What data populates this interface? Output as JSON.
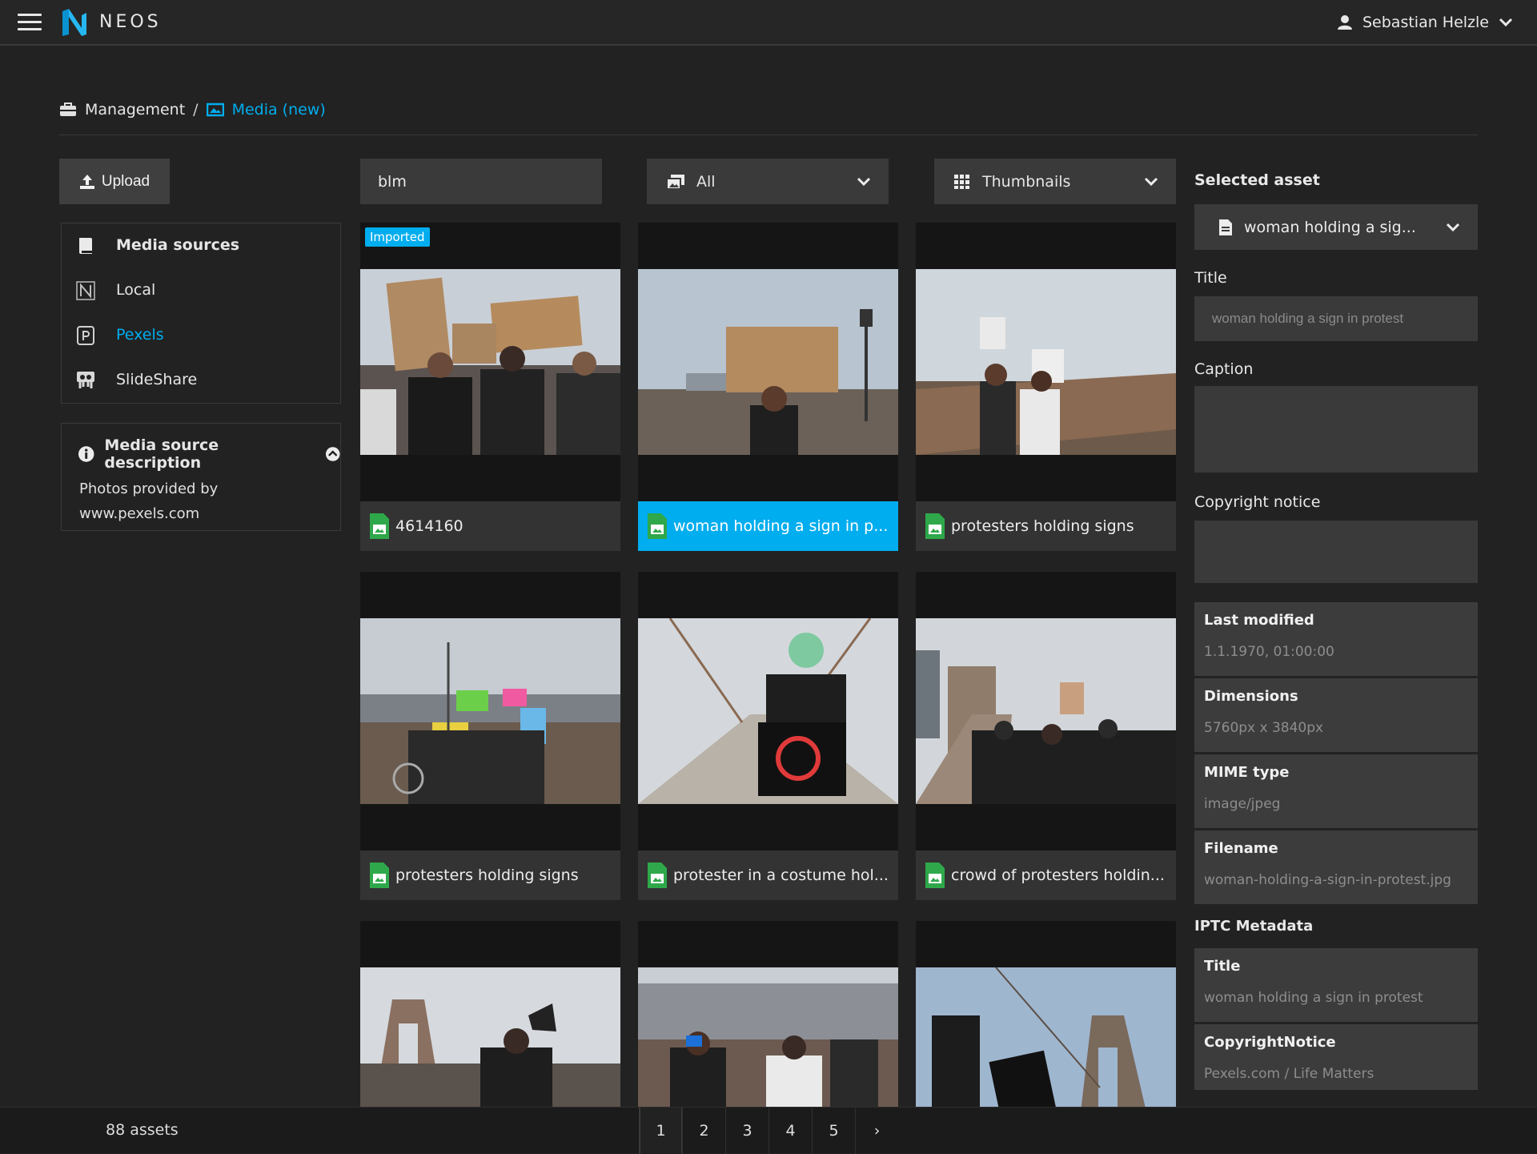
{
  "app": {
    "brand": "NEOS",
    "user_name": "Sebastian Helzle"
  },
  "breadcrumb": [
    {
      "label": "Management",
      "icon": "briefcase-icon"
    },
    {
      "label": "Media (new)",
      "icon": "image-icon"
    }
  ],
  "toolbar": {
    "upload_label": "Upload",
    "search_value": "blm",
    "filter_value": "All",
    "view_value": "Thumbnails"
  },
  "sources": {
    "heading": "Media sources",
    "items": [
      {
        "label": "Local",
        "icon": "neos-icon"
      },
      {
        "label": "Pexels",
        "icon": "pexels-icon",
        "selected": true
      },
      {
        "label": "SlideShare",
        "icon": "slideshare-icon"
      }
    ]
  },
  "description": {
    "heading": "Media source description",
    "line1": "Photos provided by",
    "line2": "www.pexels.com"
  },
  "assets": [
    {
      "caption": "4614160",
      "badge": "Imported"
    },
    {
      "caption": "woman holding a sign in p...",
      "selected": true
    },
    {
      "caption": "protesters holding signs"
    },
    {
      "caption": "protesters holding signs"
    },
    {
      "caption": "protester in a costume hol..."
    },
    {
      "caption": "crowd of protesters holdin..."
    },
    {
      "caption": ""
    },
    {
      "caption": ""
    },
    {
      "caption": ""
    }
  ],
  "selected_panel": {
    "heading": "Selected asset",
    "asset_name": "woman holding a sig...",
    "title_label": "Title",
    "title_value": "woman holding a sign in protest",
    "caption_label": "Caption",
    "caption_value": "",
    "copyright_label": "Copyright notice",
    "copyright_value": "",
    "meta": [
      {
        "key": "Last modified",
        "value": "1.1.1970, 01:00:00"
      },
      {
        "key": "Dimensions",
        "value": "5760px x 3840px"
      },
      {
        "key": "MIME type",
        "value": "image/jpeg"
      },
      {
        "key": "Filename",
        "value": "woman-holding-a-sign-in-protest.jpg"
      }
    ],
    "iptc_heading": "IPTC Metadata",
    "iptc": [
      {
        "key": "Title",
        "value": "woman holding a sign in protest"
      },
      {
        "key": "CopyrightNotice",
        "value": "Pexels.com / Life Matters"
      }
    ]
  },
  "footer": {
    "count": "88 assets",
    "pages": [
      "1",
      "2",
      "3",
      "4",
      "5"
    ],
    "next": "›"
  },
  "colors": {
    "accent": "#00adee",
    "background": "#222222",
    "panel": "#3a3a3a"
  }
}
